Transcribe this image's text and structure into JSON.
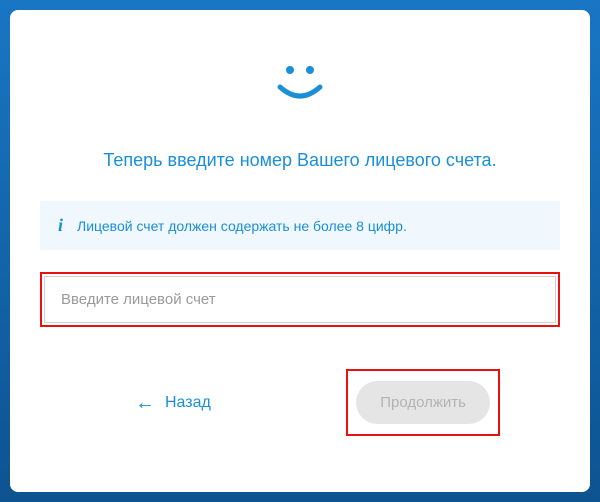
{
  "prompt": "Теперь введите номер Вашего лицевого счета.",
  "hint": {
    "icon": "i",
    "text": "Лицевой счет должен содержать не более 8 цифр."
  },
  "input": {
    "placeholder": "Введите лицевой счет",
    "value": ""
  },
  "actions": {
    "back": "Назад",
    "continue": "Продолжить"
  },
  "colors": {
    "accent": "#1a8fd8",
    "highlight": "#e81010"
  }
}
